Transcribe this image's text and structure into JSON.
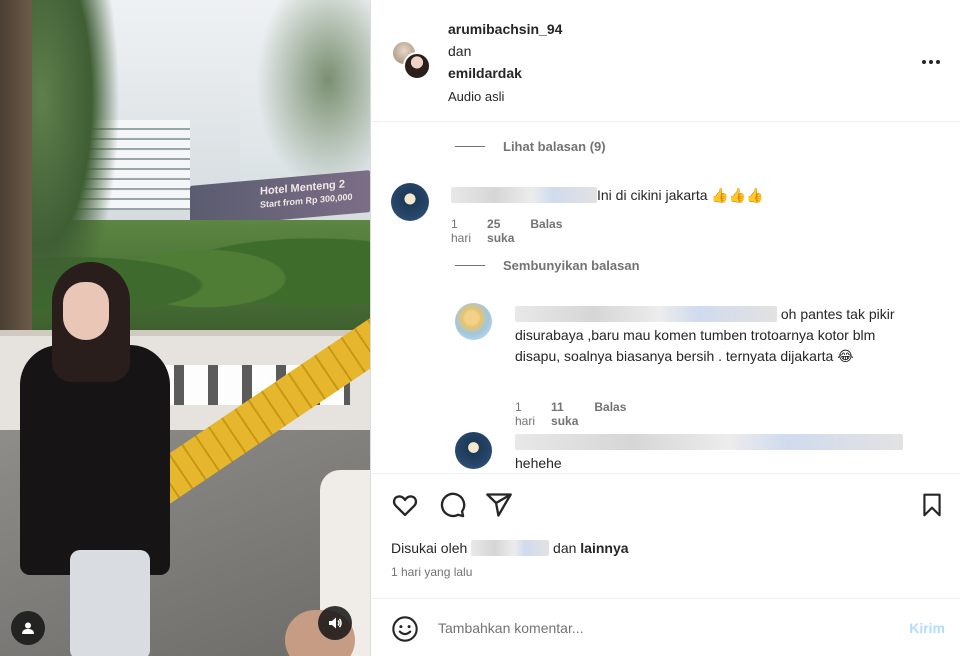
{
  "media": {
    "banner_title": "Hotel Menteng 2",
    "banner_sub": "Start from Rp 300,000"
  },
  "header": {
    "user1": "arumibachsin_94",
    "joiner": "dan",
    "user2": "emildardak",
    "audio": "Audio asli",
    "more_icon": "more-options-icon"
  },
  "comments": {
    "view_replies": "Lihat balasan (9)",
    "hide_replies": "Sembunyikan balasan",
    "items": [
      {
        "text": "Ini di cikini jakarta 👍👍👍",
        "time": "1 hari",
        "likes": "25 suka",
        "reply": "Balas"
      },
      {
        "text_tail": "oh pantes tak",
        "text_rest": "pikir disurabaya ,baru mau komen tumben trotoarnya kotor blm disapu, soalnya biasanya bersih . ternyata dijakarta 😂",
        "time": "1 hari",
        "likes": "11 suka",
        "reply": "Balas"
      },
      {
        "text": "hehehe"
      }
    ]
  },
  "actions": {
    "liked_prefix": "Disukai oleh",
    "liked_mid": "dan",
    "liked_suffix": "lainnya",
    "time_ago": "1 hari yang lalu"
  },
  "composer": {
    "placeholder": "Tambahkan komentar...",
    "send": "Kirim"
  },
  "colors": {
    "text": "#262626",
    "muted": "#737373",
    "send_disabled": "#b3dbff"
  }
}
